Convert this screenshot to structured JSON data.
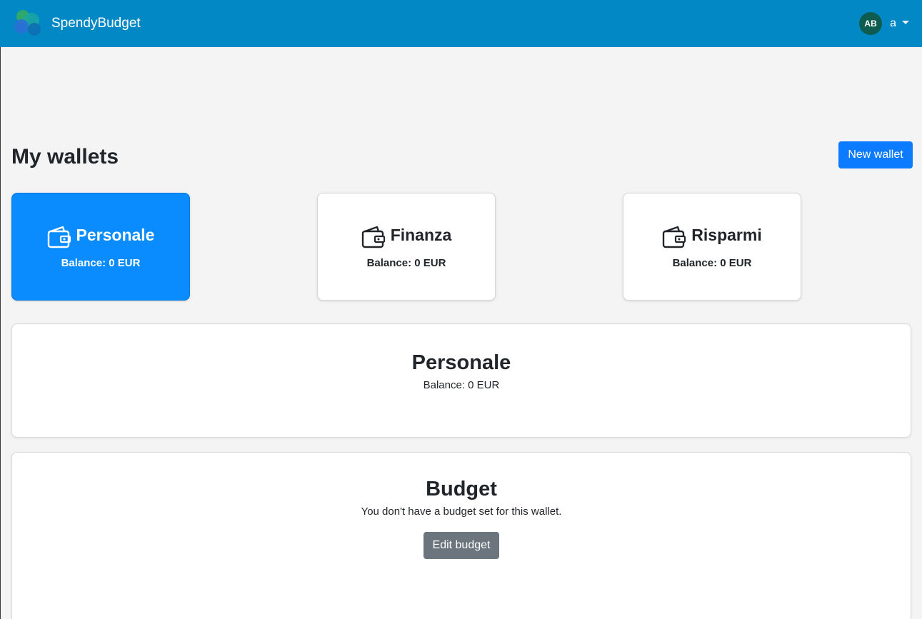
{
  "navbar": {
    "brand": "SpendyBudget",
    "avatar_initials": "AB",
    "username": "a",
    "background": "#0289c5"
  },
  "page": {
    "title": "My wallets",
    "new_wallet_label": "New wallet"
  },
  "wallets": [
    {
      "name": "Personale",
      "balance": "Balance: 0 EUR",
      "active": true,
      "icon": "wallet-icon"
    },
    {
      "name": "Finanza",
      "balance": "Balance: 0 EUR",
      "active": false,
      "icon": "wallet-icon"
    },
    {
      "name": "Risparmi",
      "balance": "Balance: 0 EUR",
      "active": false,
      "icon": "wallet-icon"
    }
  ],
  "selected_wallet": {
    "name": "Personale",
    "balance": "Balance: 0 EUR"
  },
  "budget": {
    "title": "Budget",
    "message": "You don't have a budget set for this wallet.",
    "edit_label": "Edit budget"
  },
  "colors": {
    "primary": "#0d7bff",
    "active_card": "#0a8cff",
    "secondary": "#6c757d",
    "avatar": "#0e5c4f"
  }
}
